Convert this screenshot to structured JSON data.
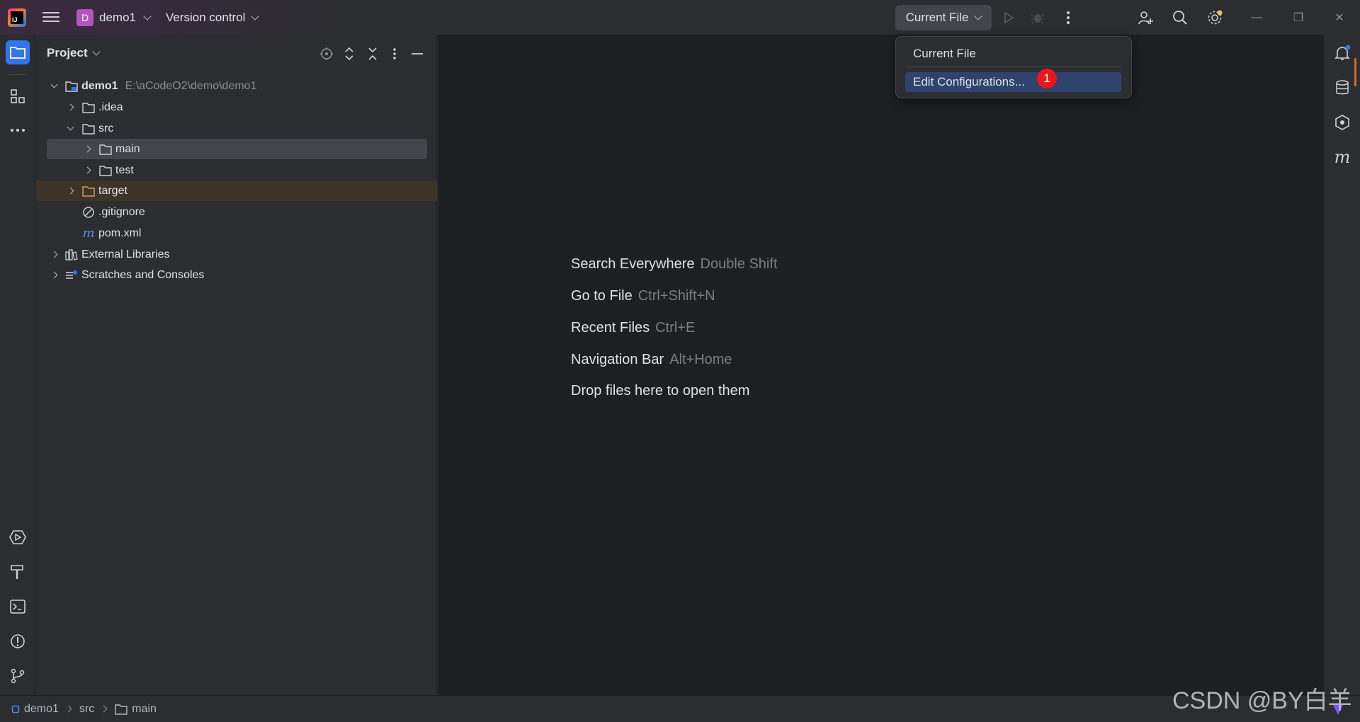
{
  "titlebar": {
    "project_badge": "D",
    "project_name": "demo1",
    "vcs_label": "Version control",
    "run_config_label": "Current File"
  },
  "project_panel": {
    "title": "Project",
    "tree": [
      {
        "label": "demo1",
        "path": "E:\\aCodeO2\\demo\\demo1"
      },
      {
        "label": ".idea"
      },
      {
        "label": "src"
      },
      {
        "label": "main"
      },
      {
        "label": "test"
      },
      {
        "label": "target"
      },
      {
        "label": ".gitignore"
      },
      {
        "label": "pom.xml"
      },
      {
        "label": "External Libraries"
      },
      {
        "label": "Scratches and Consoles"
      }
    ]
  },
  "editor": {
    "hints": [
      {
        "action": "Search Everywhere",
        "key": "Double Shift"
      },
      {
        "action": "Go to File",
        "key": "Ctrl+Shift+N"
      },
      {
        "action": "Recent Files",
        "key": "Ctrl+E"
      },
      {
        "action": "Navigation Bar",
        "key": "Alt+Home"
      },
      {
        "action": "Drop files here to open them",
        "key": ""
      }
    ]
  },
  "popup": {
    "items": [
      {
        "label": "Current File"
      },
      {
        "label": "Edit Configurations..."
      }
    ],
    "step_badge": "1"
  },
  "statusbar": {
    "crumbs": [
      "demo1",
      "src",
      "main"
    ]
  },
  "watermark": "CSDN @BY白羊",
  "colors": {
    "accent": "#3574f0",
    "popup_highlight": "#2e436e",
    "step_badge": "#e8171c",
    "excluded_folder": "#d99a5b"
  }
}
